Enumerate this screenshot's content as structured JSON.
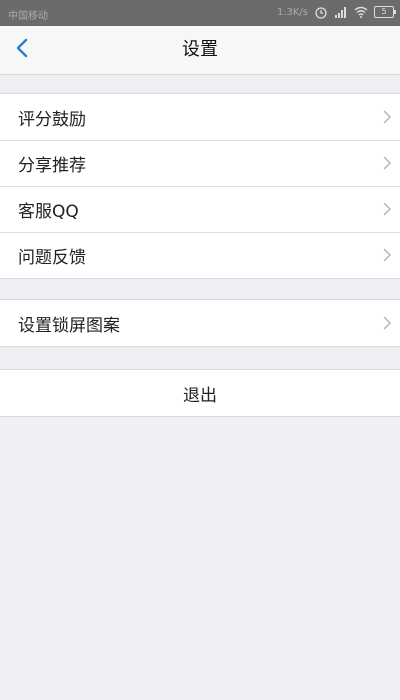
{
  "status_bar": {
    "carrier": "中国移动",
    "speed": "1.3K/s",
    "battery": "5"
  },
  "nav": {
    "title": "设置",
    "back_icon": "chevron-left-icon",
    "accent": "#2a7fd4"
  },
  "groups": [
    {
      "items": [
        {
          "label": "评分鼓励"
        },
        {
          "label": "分享推荐"
        },
        {
          "label": "客服QQ"
        },
        {
          "label": "问题反馈"
        }
      ]
    },
    {
      "items": [
        {
          "label": "设置锁屏图案"
        }
      ]
    }
  ],
  "logout": {
    "label": "退出"
  }
}
